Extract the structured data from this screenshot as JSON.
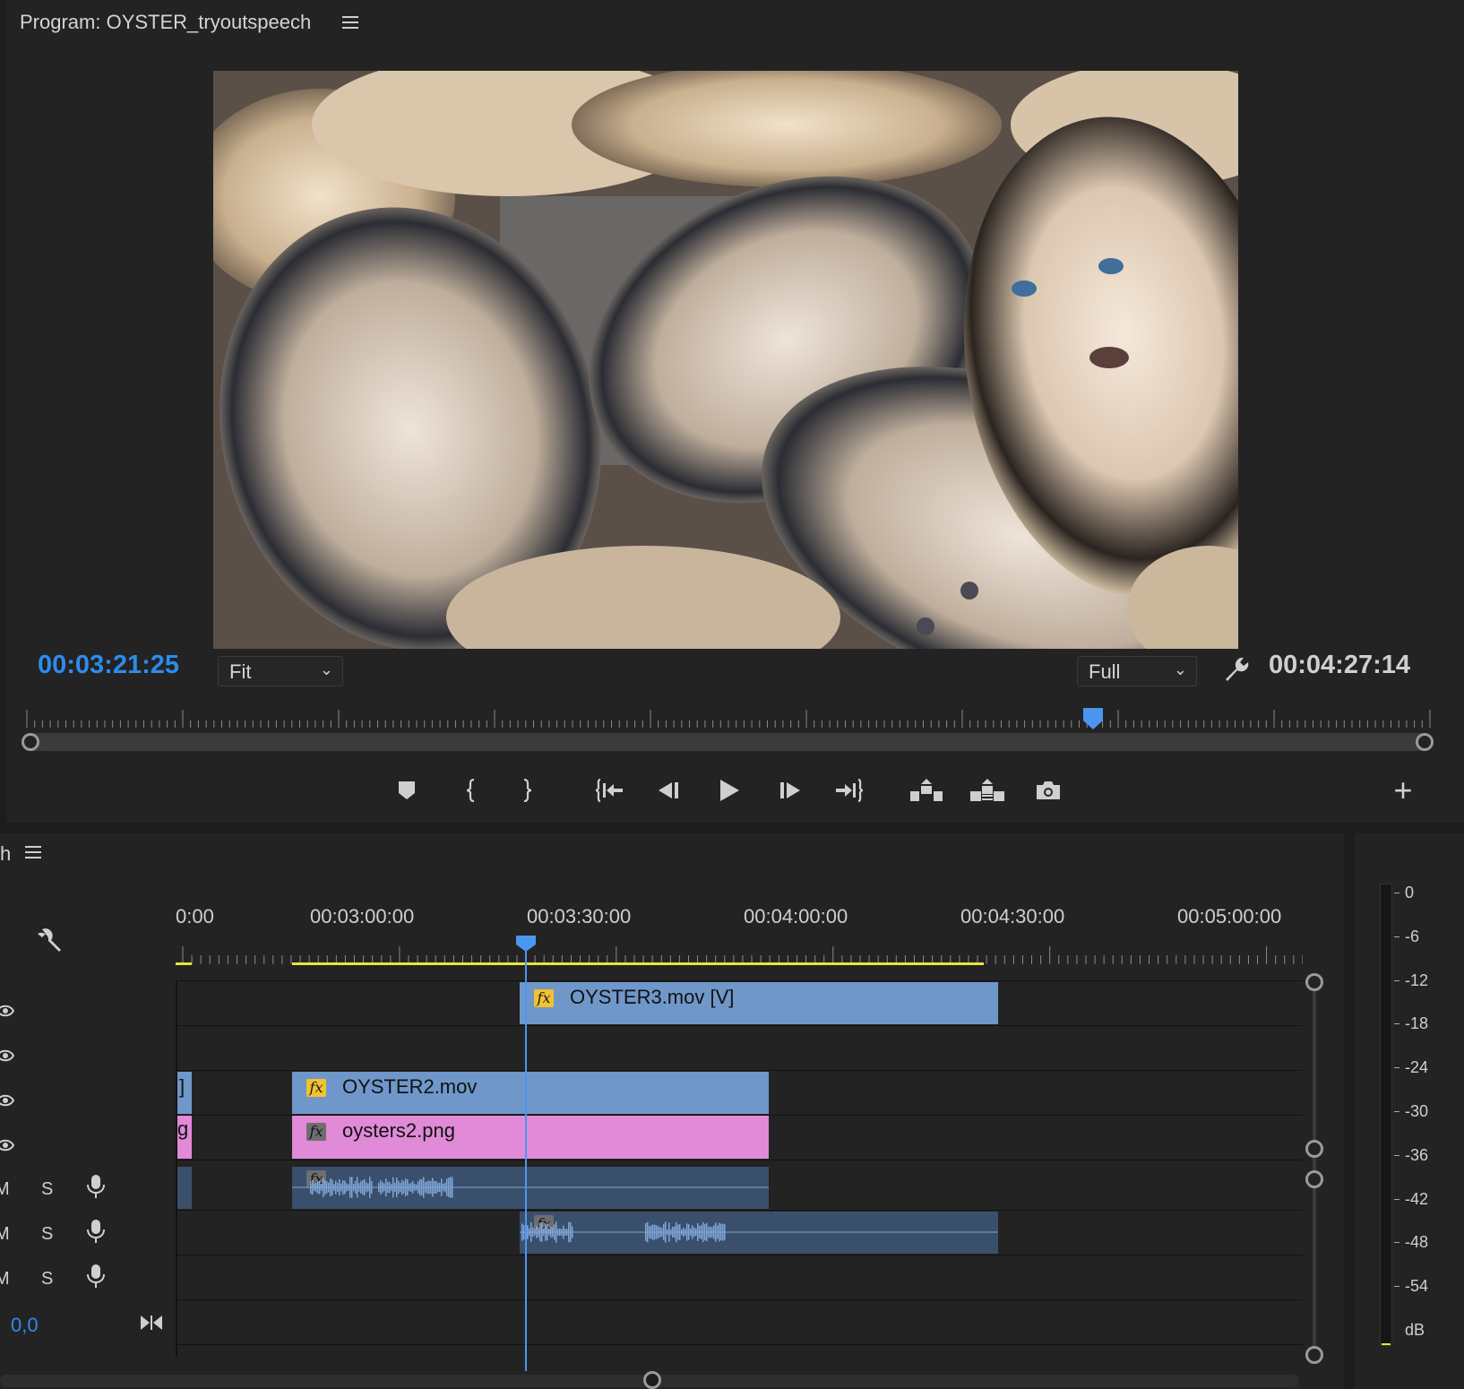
{
  "program_monitor": {
    "title": "Program: OYSTER_tryoutspeech",
    "current_timecode": "00:03:21:25",
    "duration_timecode": "00:04:27:14",
    "zoom_select": "Fit",
    "resolution_select": "Full",
    "playhead_position_fraction": 0.76
  },
  "transport_buttons": [
    {
      "name": "add-marker-icon"
    },
    {
      "name": "mark-in-icon"
    },
    {
      "name": "mark-out-icon"
    },
    {
      "name": "go-to-in-icon"
    },
    {
      "name": "step-back-icon"
    },
    {
      "name": "play-icon"
    },
    {
      "name": "step-forward-icon"
    },
    {
      "name": "go-to-out-icon"
    },
    {
      "name": "lift-icon"
    },
    {
      "name": "extract-icon"
    },
    {
      "name": "export-frame-icon"
    }
  ],
  "timeline": {
    "tab_fragment": "h",
    "ruler_labels": [
      "0:00",
      "00:03:00:00",
      "00:03:30:00",
      "00:04:00:00",
      "00:04:30:00",
      "00:05:00:00"
    ],
    "clips": {
      "v3": "OYSTER3.mov [V]",
      "v1_partial": "]",
      "v1": "OYSTER2.mov",
      "v0_partial": "g",
      "v0": "oysters2.png"
    },
    "audio_tracks": [
      {
        "mute": "M",
        "solo": "S"
      },
      {
        "mute": "M",
        "solo": "S"
      },
      {
        "mute": "M",
        "solo": "S"
      }
    ],
    "master_value": "0,0"
  },
  "meter": {
    "db_labels": [
      "0",
      "-6",
      "-12",
      "-18",
      "-24",
      "-30",
      "-36",
      "-42",
      "-48",
      "-54",
      "dB"
    ]
  },
  "colors": {
    "accent_blue": "#2d8ceb",
    "video_clip": "#6f97c9",
    "image_clip": "#e08ad8",
    "audio_clip": "#3a4f6b",
    "work_area": "#e8e33a"
  }
}
